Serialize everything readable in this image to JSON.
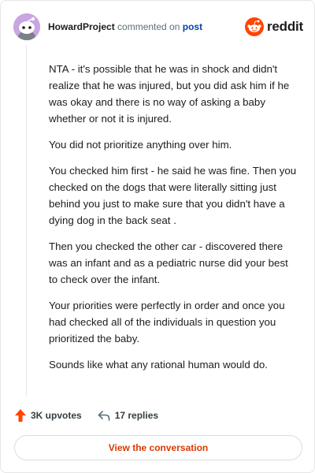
{
  "header": {
    "author": "HowardProject",
    "action_text": "commented on",
    "post_link": "post",
    "brand": "reddit"
  },
  "comment": {
    "paragraphs": [
      "NTA - it's possible that he was in shock and didn't realize that he was injured, but you did ask him if he was okay and there is no way of asking a baby whether or not it is injured.",
      "You did not prioritize anything over him.",
      "You checked him first - he said he was fine. Then you checked on the dogs that were literally sitting just behind you just to make sure that you didn't have a dying dog in the back seat .",
      "Then you checked the other car - discovered there was an infant and as a pediatric nurse did your best to check over the infant.",
      "Your priorities were perfectly in order and once you had checked all of the individuals in question you prioritized the baby.",
      "Sounds like what any rational human would do."
    ]
  },
  "footer": {
    "upvotes": "3K upvotes",
    "replies": "17 replies",
    "cta": "View the conversation"
  },
  "colors": {
    "accent": "#ff4500",
    "link": "#0045ac",
    "cta_text": "#d93a00",
    "avatar_bg": "#c8a6e0"
  },
  "icons": {
    "avatar": "snoo-avatar-icon",
    "brand": "reddit-logo-icon",
    "upvote": "upvote-arrow-icon",
    "reply": "reply-arrow-icon"
  }
}
